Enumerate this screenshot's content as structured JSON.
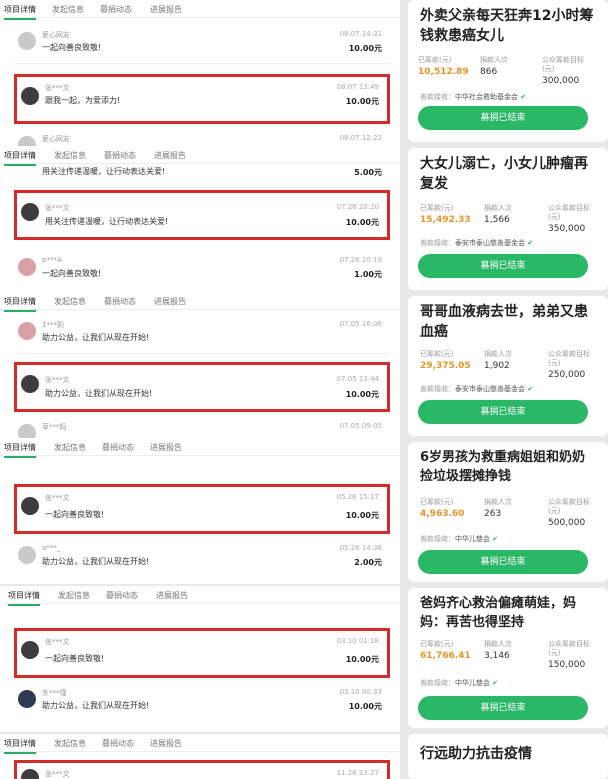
{
  "tabs": [
    "项目详情",
    "发起信息",
    "募捐动态",
    "进展报告"
  ],
  "donations": {
    "r1": {
      "name": "爱心网友",
      "time": "08.07 14:31",
      "msg": "一起向善良致敬!",
      "amount": "10.00元"
    },
    "r2": {
      "name": "张***文",
      "time": "08.07 13:49",
      "msg": "跟我一起，为爱添力!",
      "amount": "10.00元"
    },
    "r3": {
      "name": "爱心网友",
      "time": "08.07 12:22"
    },
    "r4": {
      "msg": "用关注传递温暖，让行动表达关爱!",
      "amount": "5.00元"
    },
    "r5": {
      "name": "张***文",
      "time": "07.26 20:20",
      "msg": "用关注传递温暖，让行动表达关爱!",
      "amount": "10.00元"
    },
    "r6": {
      "name": "p***A",
      "time": "07.26 20:19",
      "msg": "一起向善良致敬!",
      "amount": "1.00元"
    },
    "r7": {
      "name": "1***奶",
      "time": "07.05 16:06",
      "msg": "助力公益，让我们从现在开始!"
    },
    "r8": {
      "name": "张***文",
      "time": "07.05 13:44",
      "msg": "助力公益，让我们从现在开始!",
      "amount": "10.00元"
    },
    "r9": {
      "name": "草***妈",
      "time": "07.05 09:05"
    },
    "r10": {
      "name": "张***文",
      "time": "05.26 15:17",
      "msg": "一起向善良致敬!",
      "amount": "10.00元"
    },
    "r11": {
      "name": "a***_",
      "time": "05.26 14:38",
      "msg": "助力公益，让我们从现在开始!",
      "amount": "2.00元"
    },
    "r12": {
      "name": "张***文",
      "time": "03.10 01:18",
      "msg": "一起向善良致敬!",
      "amount": "10.00元"
    },
    "r13": {
      "name": "东***瑾",
      "time": "03.10 00:33",
      "msg": "助力公益，让我们从现在开始!",
      "amount": "10.00元"
    },
    "r14": {
      "name": "张***文",
      "time": "11.28 13:27"
    }
  },
  "stat_labels": {
    "raised": "已筹款(元)",
    "donors": "捐款人次",
    "target": "公众筹款目标(元)",
    "org_prefix": "善款接收："
  },
  "cards": [
    {
      "title": "外卖父亲每天狂奔12小时筹钱救患癌女儿",
      "raised": "10,512.89",
      "donors": "866",
      "target": "300,000",
      "org": "中华社会救助基金会",
      "button": "募捐已结束"
    },
    {
      "title": "大女儿溺亡，小女儿肿瘤再复发",
      "raised": "15,492.33",
      "donors": "1,566",
      "target": "350,000",
      "org": "泰安市泰山慈善基金会",
      "button": "募捐已结束"
    },
    {
      "title": "哥哥血液病去世，弟弟又患血癌",
      "raised": "29,375.05",
      "donors": "1,902",
      "target": "250,000",
      "org": "泰安市泰山慈善基金会",
      "button": "募捐已结束"
    },
    {
      "title": "6岁男孩为救重病姐姐和奶奶捡垃圾摆摊挣钱",
      "raised": "4,963.60",
      "donors": "263",
      "target": "500,000",
      "org": "中华儿慈会",
      "button": "募捐已结束"
    },
    {
      "title": "爸妈齐心救治偏瘫萌娃，妈妈：再苦也得坚持",
      "raised": "61,766.41",
      "donors": "3,146",
      "target": "150,000",
      "org": "中华儿慈会",
      "button": "募捐已结束"
    },
    {
      "title": "行远助力抗击疫情"
    }
  ]
}
